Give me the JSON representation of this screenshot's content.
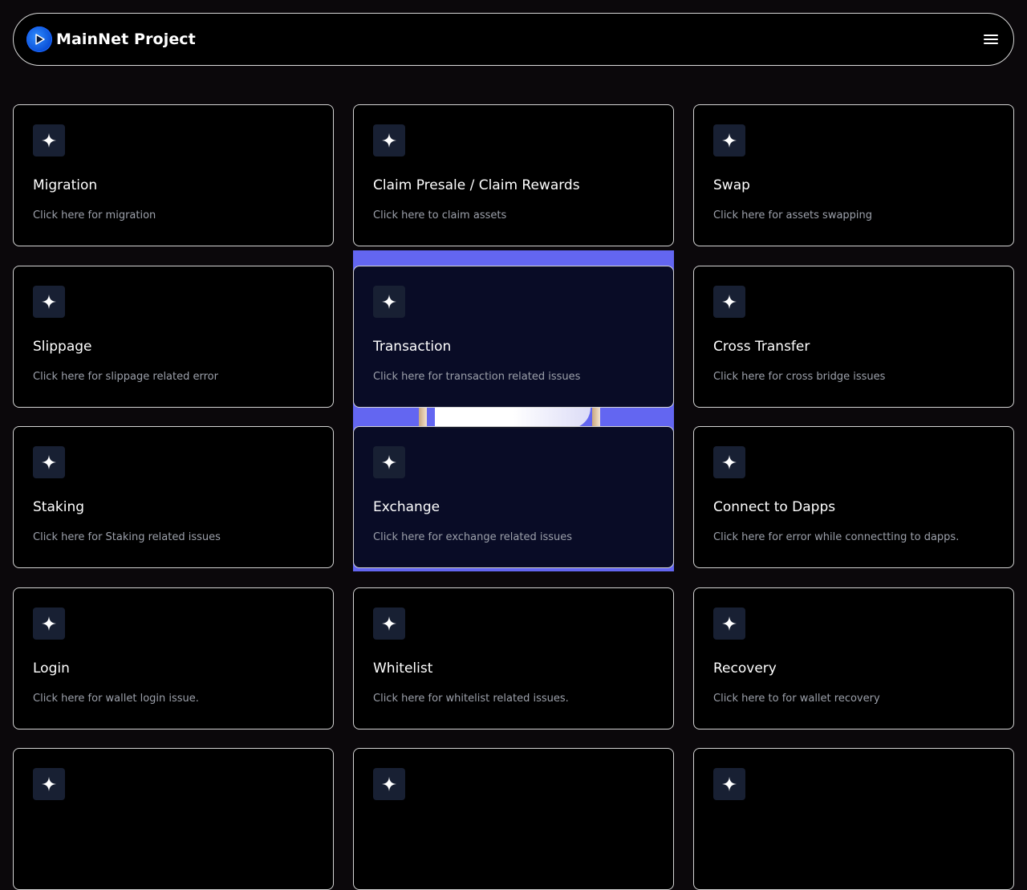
{
  "header": {
    "title": "MainNet Project",
    "logo_icon": "play-logo-icon",
    "menu_icon": "hamburger-menu-icon"
  },
  "colors": {
    "background": "#0b080b",
    "card_background": "#000000",
    "card_border": "#d4d4d4",
    "icon_box": "#182033",
    "highlight": "#6366f1"
  },
  "cards": [
    {
      "title": "Migration",
      "desc": "Click here for migration"
    },
    {
      "title": "Claim Presale / Claim Rewards",
      "desc": "Click here to claim assets"
    },
    {
      "title": "Swap",
      "desc": "Click here for assets swapping"
    },
    {
      "title": "Slippage",
      "desc": "Click here for slippage related error"
    },
    {
      "title": "Transaction",
      "desc": "Click here for transaction related issues"
    },
    {
      "title": "Cross Transfer",
      "desc": "Click here for cross bridge issues"
    },
    {
      "title": "Staking",
      "desc": "Click here for Staking related issues"
    },
    {
      "title": "Exchange",
      "desc": "Click here for exchange related issues"
    },
    {
      "title": "Connect to Dapps",
      "desc": "Click here for error while connectting to dapps."
    },
    {
      "title": "Login",
      "desc": "Click here for wallet login issue."
    },
    {
      "title": "Whitelist",
      "desc": "Click here for whitelist related issues."
    },
    {
      "title": "Recovery",
      "desc": "Click here to for wallet recovery"
    },
    {
      "title": "",
      "desc": ""
    },
    {
      "title": "",
      "desc": ""
    },
    {
      "title": "",
      "desc": ""
    }
  ],
  "card_icon": "sparkle-icon"
}
